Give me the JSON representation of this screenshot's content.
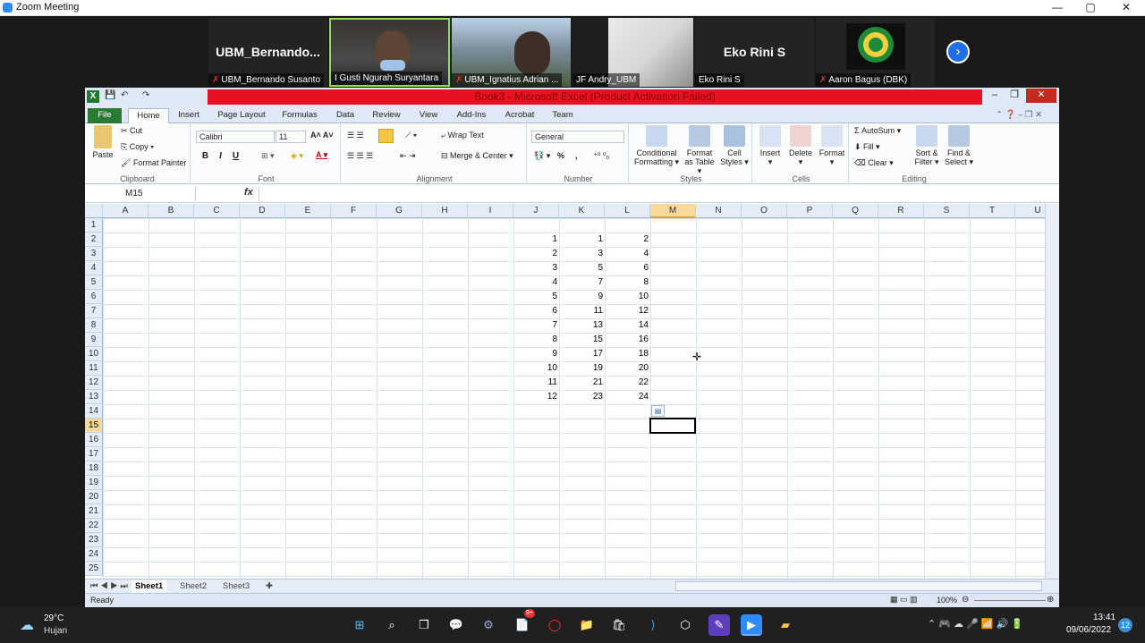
{
  "zoom": {
    "window_title": "Zoom Meeting",
    "controls": [
      "—",
      "▢",
      "✕"
    ],
    "participants": [
      {
        "display": "UBM_Bernando...",
        "name": "UBM_Bernando Susanto",
        "muted": true
      },
      {
        "display": "",
        "name": "I Gusti Ngurah Suryantara",
        "muted": false
      },
      {
        "display": "",
        "name": "UBM_Ignatius Adrian ...",
        "muted": true
      },
      {
        "display": "",
        "name": "JF Andry_UBM",
        "muted": false
      },
      {
        "display": "Eko Rini S",
        "name": "Eko Rini S",
        "muted": false
      },
      {
        "display": "",
        "name": "Aaron Bagus (DBK)",
        "muted": true
      }
    ],
    "next_icon": "›"
  },
  "excel": {
    "title": "Book3 - Microsoft Excel (Product Activation Failed)",
    "tabs": [
      "File",
      "Home",
      "Insert",
      "Page Layout",
      "Formulas",
      "Data",
      "Review",
      "View",
      "Add-Ins",
      "Acrobat",
      "Team"
    ],
    "ribbon": {
      "clipboard": {
        "label": "Clipboard",
        "paste": "Paste",
        "cut": "Cut",
        "copy": "Copy",
        "format_painter": "Format Painter"
      },
      "font": {
        "label": "Font",
        "name": "Calibri",
        "size": "11",
        "bold": "B",
        "italic": "I",
        "underline": "U"
      },
      "alignment": {
        "label": "Alignment",
        "wrap": "Wrap Text",
        "merge": "Merge & Center"
      },
      "number": {
        "label": "Number",
        "format": "General",
        "percent": "%",
        "comma": ","
      },
      "styles": {
        "label": "Styles",
        "cond1": "Conditional",
        "cond2": "Formatting",
        "fmt1": "Format",
        "fmt2": "as Table",
        "cell1": "Cell",
        "cell2": "Styles"
      },
      "cells": {
        "label": "Cells",
        "insert": "Insert",
        "delete": "Delete",
        "format": "Format"
      },
      "editing": {
        "label": "Editing",
        "autosum": "AutoSum",
        "fill": "Fill",
        "clear": "Clear",
        "sort1": "Sort &",
        "sort2": "Filter",
        "find1": "Find &",
        "find2": "Select"
      }
    },
    "name_box": "M15",
    "fx": "fx",
    "columns": [
      "A",
      "B",
      "C",
      "D",
      "E",
      "F",
      "G",
      "H",
      "I",
      "J",
      "K",
      "L",
      "M",
      "N",
      "O",
      "P",
      "Q",
      "R",
      "S",
      "T",
      "U"
    ],
    "active_column": "M",
    "active_row": 15,
    "rows": [
      1,
      2,
      3,
      4,
      5,
      6,
      7,
      8,
      9,
      10,
      11,
      12,
      13,
      14,
      15,
      16,
      17,
      18,
      19,
      20,
      21,
      22,
      23,
      24,
      25
    ],
    "cell_data": [
      [
        "1",
        "1",
        "2"
      ],
      [
        "2",
        "3",
        "4"
      ],
      [
        "3",
        "5",
        "6"
      ],
      [
        "4",
        "7",
        "8"
      ],
      [
        "5",
        "9",
        "10"
      ],
      [
        "6",
        "11",
        "12"
      ],
      [
        "7",
        "13",
        "14"
      ],
      [
        "8",
        "15",
        "16"
      ],
      [
        "9",
        "17",
        "18"
      ],
      [
        "10",
        "19",
        "20"
      ],
      [
        "11",
        "21",
        "22"
      ],
      [
        "12",
        "23",
        "24"
      ]
    ],
    "sheets": [
      "Sheet1",
      "Sheet2",
      "Sheet3"
    ],
    "status": "Ready",
    "zoom_level": "100%"
  },
  "taskbar": {
    "weather_temp": "29°C",
    "weather_text": "Hujan",
    "time": "13:41",
    "date": "09/06/2022",
    "notifications": "12",
    "badge": "9+"
  }
}
